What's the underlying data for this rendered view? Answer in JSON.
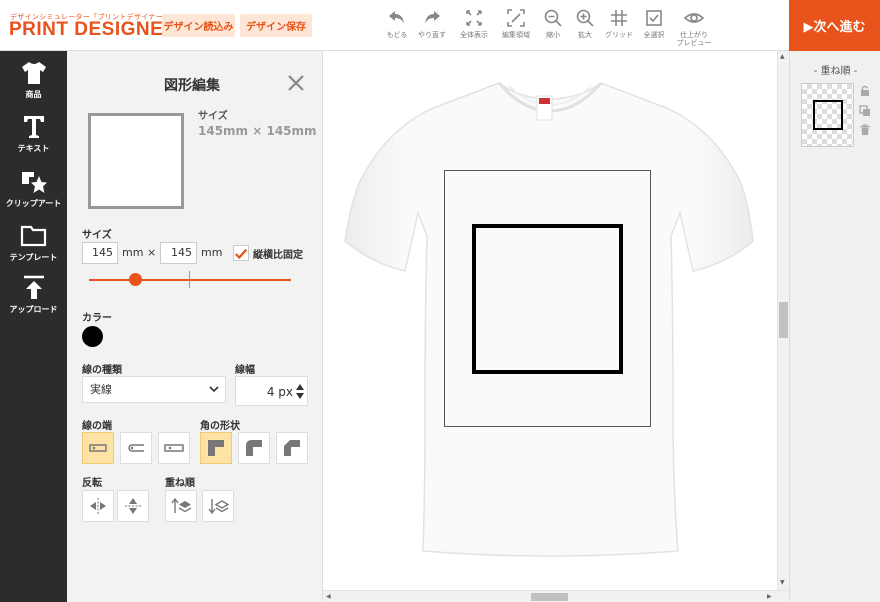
{
  "header": {
    "logo_sub": "デザインシミュレーター「プリントデザイナー」",
    "logo_main": "PRINT DESIGNER",
    "load_label": "デザイン読込み",
    "save_label": "デザイン保存",
    "tools": [
      {
        "label": "もどる",
        "icon": "undo-icon"
      },
      {
        "label": "やり直す",
        "icon": "redo-icon"
      },
      {
        "label": "全体表示",
        "icon": "fit-view-icon"
      },
      {
        "label": "編集領域",
        "icon": "edit-area-icon"
      },
      {
        "label": "縮小",
        "icon": "zoom-out-icon"
      },
      {
        "label": "拡大",
        "icon": "zoom-in-icon"
      },
      {
        "label": "グリッド",
        "icon": "grid-icon"
      },
      {
        "label": "全選択",
        "icon": "select-all-icon"
      },
      {
        "label": "仕上がり",
        "label2": "プレビュー",
        "icon": "preview-eye-icon"
      }
    ],
    "next_label": "▶次へ進む"
  },
  "sidebar": {
    "items": [
      {
        "label": "商品",
        "icon": "tshirt-icon"
      },
      {
        "label": "テキスト",
        "icon": "text-t-icon"
      },
      {
        "label": "クリップアート",
        "icon": "clipart-icon"
      },
      {
        "label": "テンプレート",
        "icon": "folder-icon"
      },
      {
        "label": "アップロード",
        "icon": "upload-icon"
      }
    ]
  },
  "panel": {
    "title": "図形編集",
    "size_heading": "サイズ",
    "size_display": "145mm × 145mm",
    "size_label": "サイズ",
    "width_value": "145",
    "height_value": "145",
    "unit": "mm",
    "times": "×",
    "keep_ratio_label": "縦横比固定",
    "keep_ratio_checked": true,
    "slider_fraction": 0.23,
    "color_label": "カラー",
    "color_value": "#000000",
    "line_type_label": "線の種類",
    "line_type_value": "実線",
    "line_width_label": "線幅",
    "line_width_value": "4 px",
    "line_end_label": "線の端",
    "corner_label": "角の形状",
    "flip_label": "反転",
    "order_label": "重ね順"
  },
  "layers": {
    "title": "- 重ね順 -"
  },
  "colors": {
    "accent": "#e8531b",
    "accent_light": "#fde6d6",
    "selected_option": "#fde4a6",
    "sidebar_bg": "#2c2c2c"
  }
}
